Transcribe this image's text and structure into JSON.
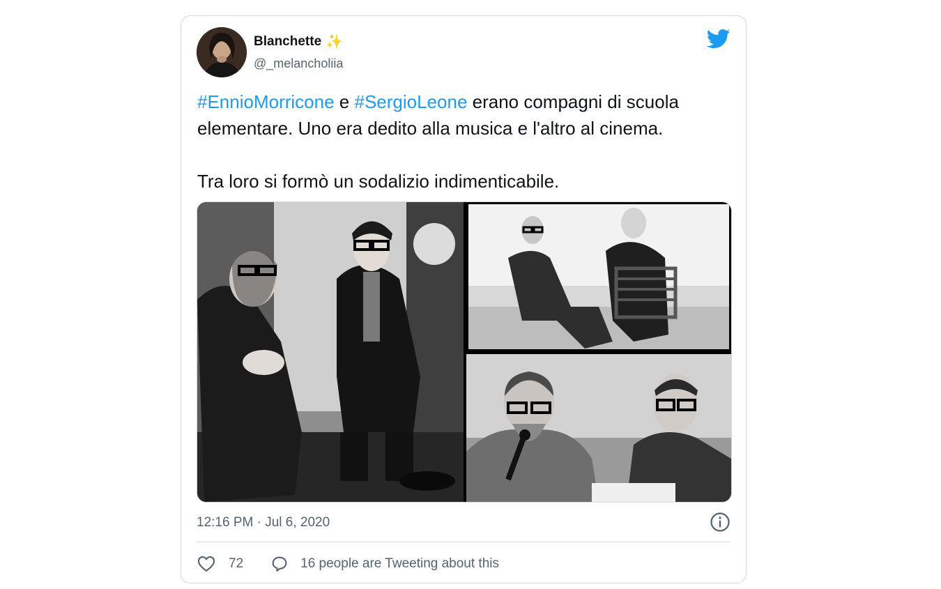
{
  "tweet": {
    "display_name": "Blanchette",
    "name_emoji": "✨",
    "handle": "@_melancholiia",
    "text_parts": {
      "hashtag1": "#EnnioMorricone",
      "connector": " e ",
      "hashtag2": "#SergioLeone",
      "body": " erano compagni di scuola elementare. Uno era dedito alla musica e l'altro al cinema.\n\nTra loro si formò un sodalizio indimenticabile."
    },
    "timestamp": "12:16 PM · Jul 6, 2020",
    "like_count": "72",
    "reply_text": "16 people are Tweeting about this"
  },
  "icons": {
    "brand": "twitter-bird-icon",
    "info": "info-icon",
    "like": "heart-icon",
    "reply": "speech-bubble-icon"
  },
  "colors": {
    "hashtag": "#1d9bf0",
    "brand_blue": "#1d9bf0",
    "secondary_text": "#536471",
    "border": "#cfd9de"
  }
}
